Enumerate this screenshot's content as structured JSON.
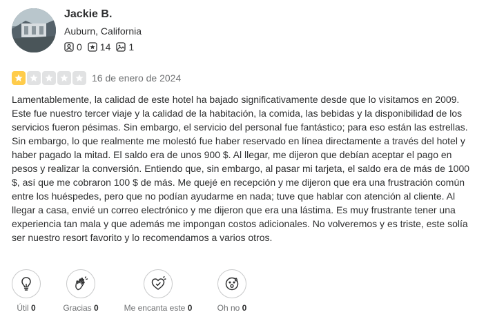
{
  "user": {
    "name": "Jackie B.",
    "location": "Auburn, California",
    "stats": {
      "friends": "0",
      "reviews": "14",
      "photos": "1"
    }
  },
  "review": {
    "rating": 1,
    "max_rating": 5,
    "date": "16 de enero de 2024",
    "text": "Lamentablemente, la calidad de este hotel ha bajado significativamente desde que lo visitamos en 2009. Este fue nuestro tercer viaje y la calidad de la habitación, la comida, las bebidas y la disponibilidad de los servicios fueron pésimas. Sin embargo, el servicio del personal fue fantástico; para eso están las estrellas. Sin embargo, lo que realmente me molestó fue haber reservado en línea directamente a través del hotel y haber pagado la mitad. El saldo era de unos 900 $. Al llegar, me dijeron que debían aceptar el pago en pesos y realizar la conversión. Entiendo que, sin embargo, al pasar mi tarjeta, el saldo era de más de 1000 $, así que me cobraron 100 $ de más. Me quejé en recepción y me dijeron que era una frustración común entre los huéspedes, pero que no podían ayudarme en nada; tuve que hablar con atención al cliente. Al llegar a casa, envié un correo electrónico y me dijeron que era una lástima. Es muy frustrante tener una experiencia tan mala y que además me impongan costos adicionales. No volveremos y es triste, este solía ser nuestro resort favorito y lo recomendamos a varios otros."
  },
  "reactions": [
    {
      "label": "Útil",
      "count": "0",
      "icon": "lightbulb-icon"
    },
    {
      "label": "Gracias",
      "count": "0",
      "icon": "clapping-hands-icon"
    },
    {
      "label": "Me encanta este",
      "count": "0",
      "icon": "heart-icon"
    },
    {
      "label": "Oh no",
      "count": "0",
      "icon": "surprised-face-icon"
    }
  ],
  "colors": {
    "star_active": "#ffcc4b",
    "star_inactive": "#e1e2e3",
    "text": "#2d2e2f",
    "muted": "#6e7072"
  }
}
